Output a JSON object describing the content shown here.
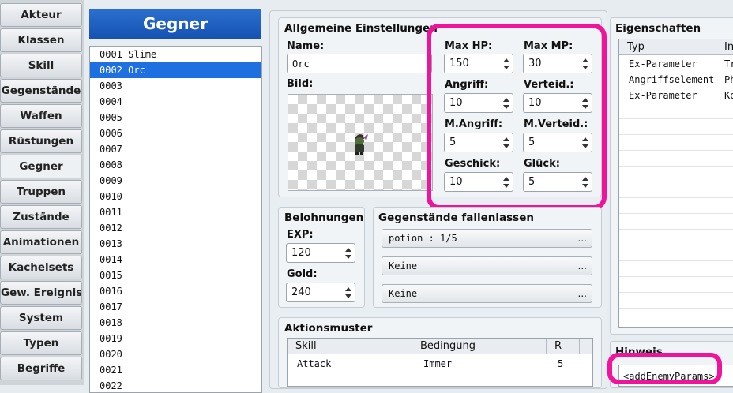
{
  "nav": {
    "items": [
      "Akteur",
      "Klassen",
      "Skill",
      "Gegenstände",
      "Waffen",
      "Rüstungen",
      "Gegner",
      "Truppen",
      "Zustände",
      "Animationen",
      "Kachelsets",
      "Gew. Ereignisse",
      "System",
      "Typen",
      "Begriffe"
    ],
    "active": "Gegner"
  },
  "enemy_list": {
    "header": "Gegner",
    "rows": [
      "0001 Slime",
      "0002 Orc",
      "0003",
      "0004",
      "0005",
      "0006",
      "0007",
      "0008",
      "0009",
      "0010",
      "0011",
      "0012",
      "0013",
      "0014",
      "0015",
      "0016",
      "0017",
      "0018",
      "0019",
      "0020",
      "0021",
      "0022"
    ],
    "selected": "0002 Orc"
  },
  "general": {
    "title": "Allgemeine Einstellungen",
    "name_label": "Name:",
    "name_value": "Orc",
    "image_label": "Bild:"
  },
  "params": {
    "maxhp_label": "Max HP:",
    "maxhp": "150",
    "maxmp_label": "Max MP:",
    "maxmp": "30",
    "atk_label": "Angriff:",
    "atk": "10",
    "def_label": "Verteid.:",
    "def": "10",
    "mat_label": "M.Angriff:",
    "mat": "5",
    "mdf_label": "M.Verteid.:",
    "mdf": "5",
    "agi_label": "Geschick:",
    "agi": "10",
    "luk_label": "Glück:",
    "luk": "5"
  },
  "rewards": {
    "title": "Belohnungen",
    "exp_label": "EXP:",
    "exp": "120",
    "gold_label": "Gold:",
    "gold": "240"
  },
  "drops": {
    "title": "Gegenstände fallenlassen",
    "items": [
      "potion : 1/5",
      "Keine",
      "Keine"
    ],
    "ellipsis": "..."
  },
  "actions": {
    "title": "Aktionsmuster",
    "headers": [
      "Skill",
      "Bedingung",
      "R"
    ],
    "rows": [
      {
        "skill": "Attack",
        "condition": "Immer",
        "rating": "5"
      }
    ]
  },
  "traits": {
    "title": "Eigenschaften",
    "headers": [
      "Typ",
      "In"
    ],
    "rows": [
      {
        "type": "Ex-Parameter",
        "content": "Tr"
      },
      {
        "type": "Angriffselement",
        "content": "Ph"
      },
      {
        "type": "Ex-Parameter",
        "content": "Ko"
      }
    ]
  },
  "note": {
    "title": "Hinweis",
    "text": "<addEnemyParams>"
  },
  "colors": {
    "highlight": "#f0139b",
    "selection": "#1e6fe0",
    "header": "#1552b2"
  }
}
